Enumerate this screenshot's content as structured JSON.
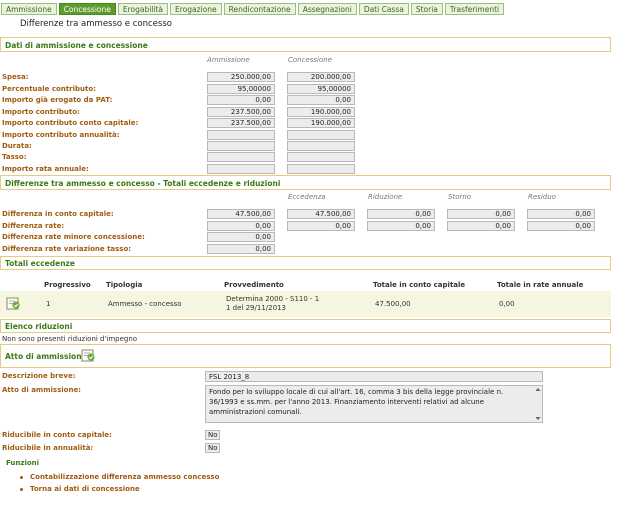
{
  "tabs": [
    {
      "label": "Ammissione",
      "active": false
    },
    {
      "label": "Concessione",
      "active": true
    },
    {
      "label": "Erogabilità",
      "active": false
    },
    {
      "label": "Erogazione",
      "active": false
    },
    {
      "label": "Rendicontazione",
      "active": false
    },
    {
      "label": "Assegnazioni",
      "active": false
    },
    {
      "label": "Dati Cassa",
      "active": false
    },
    {
      "label": "Storia",
      "active": false
    },
    {
      "label": "Trasferimenti",
      "active": false
    }
  ],
  "page_title": "Differenze tra ammesso e concesso",
  "dati": {
    "section_title": "Dati di ammissione e concessione",
    "col_ammissione": "Ammissione",
    "col_concessione": "Concessione",
    "rows": [
      {
        "label": "Spesa:",
        "ammissione": "250.000,00",
        "concessione": "200.000,00"
      },
      {
        "label": "Percentuale contributo:",
        "ammissione": "95,00000",
        "concessione": "95,00000"
      },
      {
        "label": "Importo già erogato da PAT:",
        "ammissione": "0,00",
        "concessione": "0,00"
      },
      {
        "label": "Importo contributo:",
        "ammissione": "237.500,00",
        "concessione": "190.000,00"
      },
      {
        "label": "Importo contributo conto capitale:",
        "ammissione": "237.500,00",
        "concessione": "190.000,00"
      },
      {
        "label": "Importo contributo annualità:",
        "ammissione": "",
        "concessione": ""
      },
      {
        "label": "Durata:",
        "ammissione": "",
        "concessione": ""
      },
      {
        "label": "Tasso:",
        "ammissione": "",
        "concessione": ""
      },
      {
        "label": "Importo rata annuale:",
        "ammissione": "",
        "concessione": ""
      }
    ]
  },
  "differenze": {
    "section_title": "Differenze tra ammesso e concesso - Totali eccedenze e riduzioni",
    "col_eccedenza": "Eccedenza",
    "col_riduzione": "Riduzione",
    "col_storno": "Storno",
    "col_residuo": "Residuo",
    "rows": [
      {
        "label": "Differenza in conto capitale:",
        "valore": "47.500,00",
        "eccedenza": "47.500,00",
        "riduzione": "0,00",
        "storno": "0,00",
        "residuo": "0,00"
      },
      {
        "label": "Differenza rate:",
        "valore": "0,00",
        "eccedenza": "0,00",
        "riduzione": "0,00",
        "storno": "0,00",
        "residuo": "0,00"
      },
      {
        "label": "Differenza rate minore concessione:",
        "valore": "0,00"
      },
      {
        "label": "Differenza rate variazione tasso:",
        "valore": "0,00"
      }
    ]
  },
  "totali": {
    "section_title": "Totali eccedenze",
    "headers": {
      "progressivo": "Progressivo",
      "tipologia": "Tipologia",
      "provvedimento": "Provvedimento",
      "totale_capitale": "Totale in conto capitale",
      "totale_rate": "Totale in rate annuale"
    },
    "row": {
      "progressivo": "1",
      "tipologia": "Ammesso - concesso",
      "provvedimento_1": "Determina 2000 - S110 - 1",
      "provvedimento_2": "1 del 29/11/2013",
      "totale_capitale": "47.500,00",
      "totale_rate": "0,00"
    }
  },
  "riduzioni": {
    "section_title": "Elenco riduzioni",
    "empty_text": "Non sono presenti riduzioni d'impegno"
  },
  "atto": {
    "section_title": "Atto di ammissione",
    "descr_label": "Descrizione breve:",
    "descr_value": "FSL 2013_8",
    "atto_label": "Atto di ammissione:",
    "atto_value": "Fondo per lo sviluppo locale di cui all'art. 16, comma 3 bis della legge provinciale n. 36/1993 e ss.mm. per l'anno 2013. Finanziamento interventi relativi ad alcune amministrazioni comunali.",
    "rid_capitale_label": "Riducibile in conto capitale:",
    "rid_capitale_value": "No",
    "rid_annualita_label": "Riducibile in annualità:",
    "rid_annualita_value": "No"
  },
  "funzioni": {
    "title": "Funzioni",
    "links": [
      "Contabilizzazione differenza ammesso concesso",
      "Torna ai dati di concessione"
    ]
  },
  "colors": {
    "tab_active": "#5d9b2c",
    "section_title": "#3a7a16",
    "label": "#a05c10",
    "section_border": "#e6cc80"
  }
}
